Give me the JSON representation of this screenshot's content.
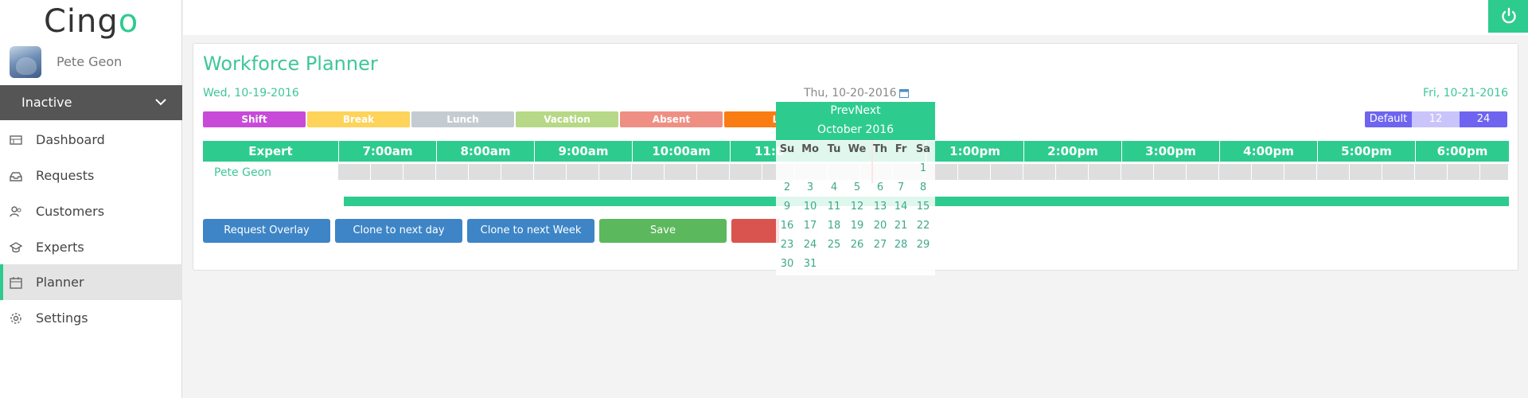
{
  "logo": {
    "text_main": "Cing",
    "text_accent": "o"
  },
  "user": {
    "name": "Pete Geon"
  },
  "status": {
    "label": "Inactive"
  },
  "nav": [
    {
      "label": "Dashboard",
      "icon": "dashboard-icon"
    },
    {
      "label": "Requests",
      "icon": "inbox-icon"
    },
    {
      "label": "Customers",
      "icon": "customers-icon"
    },
    {
      "label": "Experts",
      "icon": "graduation-cap-icon"
    },
    {
      "label": "Planner",
      "icon": "calendar-icon",
      "active": true
    },
    {
      "label": "Settings",
      "icon": "gear-icon"
    }
  ],
  "planner": {
    "title": "Workforce Planner",
    "date_prev": "Wed, 10-19-2016",
    "date_current": "Thu, 10-20-2016",
    "date_next": "Fri, 10-21-2016",
    "legend": [
      {
        "label": "Shift",
        "color": "#c74bd8"
      },
      {
        "label": "Break",
        "color": "#fdd35a"
      },
      {
        "label": "Lunch",
        "color": "#c5ccd1"
      },
      {
        "label": "Vacation",
        "color": "#b7d886"
      },
      {
        "label": "Absent",
        "color": "#ef8f84"
      },
      {
        "label": "L",
        "color": "#f97d12"
      }
    ],
    "format": {
      "default": "Default",
      "h12": "12",
      "h24": "24"
    },
    "header": {
      "expert": "Expert",
      "hours": [
        "7:00am",
        "8:00am",
        "9:00am",
        "10:00am",
        "11:0",
        "1:00pm",
        "2:00pm",
        "3:00pm",
        "4:00pm",
        "5:00pm",
        "6:00pm"
      ]
    },
    "rows": [
      {
        "name": "Pete Geon"
      }
    ],
    "buttons": {
      "request_overlay": "Request Overlay",
      "clone_next_day": "Clone to next day",
      "clone_next_week": "Clone to next Week",
      "save": "Save"
    }
  },
  "datepicker": {
    "prev": "Prev",
    "next": "Next",
    "month": "October 2016",
    "weekdays": [
      "Su",
      "Mo",
      "Tu",
      "We",
      "Th",
      "Fr",
      "Sa"
    ],
    "weeks": [
      [
        "",
        "",
        "",
        "",
        "",
        "",
        "1"
      ],
      [
        "2",
        "3",
        "4",
        "5",
        "6",
        "7",
        "8"
      ],
      [
        "9",
        "10",
        "11",
        "12",
        "13",
        "14",
        "15"
      ],
      [
        "16",
        "17",
        "18",
        "19",
        "20",
        "21",
        "22"
      ],
      [
        "23",
        "24",
        "25",
        "26",
        "27",
        "28",
        "29"
      ],
      [
        "30",
        "31",
        "",
        "",
        "",
        "",
        ""
      ]
    ]
  },
  "colors": {
    "accent": "#2ecb8f",
    "btn_blue": "#3d85c6",
    "btn_green": "#5cb85c",
    "btn_red": "#d9534f",
    "fmt_default": "#6e64f0",
    "fmt_12": "#c9c4fa",
    "fmt_24": "#6e64f0"
  }
}
